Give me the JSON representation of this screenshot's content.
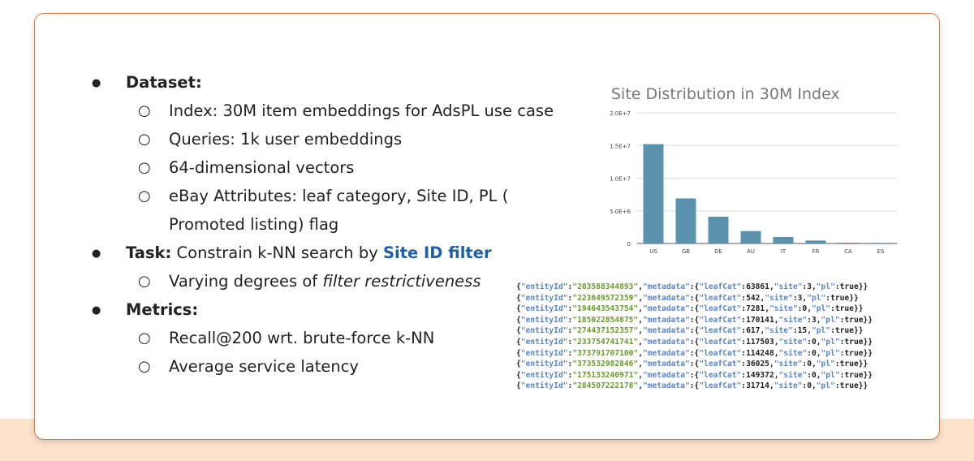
{
  "bullets": [
    {
      "level": 1,
      "bold": "Dataset:",
      "text": ""
    },
    {
      "level": 2,
      "text": "Index: 30M item embeddings for AdsPL use case"
    },
    {
      "level": 2,
      "text": "Queries: 1k user embeddings"
    },
    {
      "level": 2,
      "text": "64-dimensional vectors"
    },
    {
      "level": 2,
      "text": "eBay Attributes: leaf category, Site ID, PL ("
    },
    {
      "level": 0,
      "text": "Promoted listing) flag"
    },
    {
      "level": 1,
      "bold": "Task:",
      "text": " Constrain k-NN search by ",
      "highlight": "Site ID filter"
    },
    {
      "level": 2,
      "text": "Varying degrees of ",
      "italic": "filter restrictiveness"
    },
    {
      "level": 1,
      "bold": "Metrics:",
      "text": ""
    },
    {
      "level": 2,
      "text": "Recall@200 wrt. brute-force k-NN"
    },
    {
      "level": 2,
      "text": "Average service latency"
    }
  ],
  "markers": {
    "level1": "●",
    "level2": "○"
  },
  "chart_data": {
    "type": "bar",
    "title": "Site Distribution in 30M Index",
    "categories": [
      "US",
      "GB",
      "DE",
      "AU",
      "IT",
      "FR",
      "CA",
      "ES"
    ],
    "values": [
      15200000,
      6900000,
      4100000,
      1900000,
      1000000,
      450000,
      120000,
      100000
    ],
    "ylim": [
      0,
      20000000
    ],
    "yticks": [
      "0",
      "5.0E+6",
      "1.0E+7",
      "1.5E+7",
      "2.0E+7"
    ],
    "grid": true,
    "color": "#5a91ad"
  },
  "records": [
    {
      "entityId": "203588344893",
      "leafCat": "63861",
      "site": "3",
      "pl": "true"
    },
    {
      "entityId": "223649572359",
      "leafCat": "542",
      "site": "3",
      "pl": "true"
    },
    {
      "entityId": "194643543754",
      "leafCat": "7281",
      "site": "0",
      "pl": "true"
    },
    {
      "entityId": "185022854875",
      "leafCat": "170141",
      "site": "3",
      "pl": "true"
    },
    {
      "entityId": "274437152357",
      "leafCat": "617",
      "site": "15",
      "pl": "true"
    },
    {
      "entityId": "233754741741",
      "leafCat": "117503",
      "site": "0",
      "pl": "true"
    },
    {
      "entityId": "373791707100",
      "leafCat": "114248",
      "site": "0",
      "pl": "true"
    },
    {
      "entityId": "373532982846",
      "leafCat": "36025",
      "site": "0",
      "pl": "true"
    },
    {
      "entityId": "175133240971",
      "leafCat": "149372",
      "site": "0",
      "pl": "true"
    },
    {
      "entityId": "284507222178",
      "leafCat": "31714",
      "site": "0",
      "pl": "true"
    }
  ]
}
